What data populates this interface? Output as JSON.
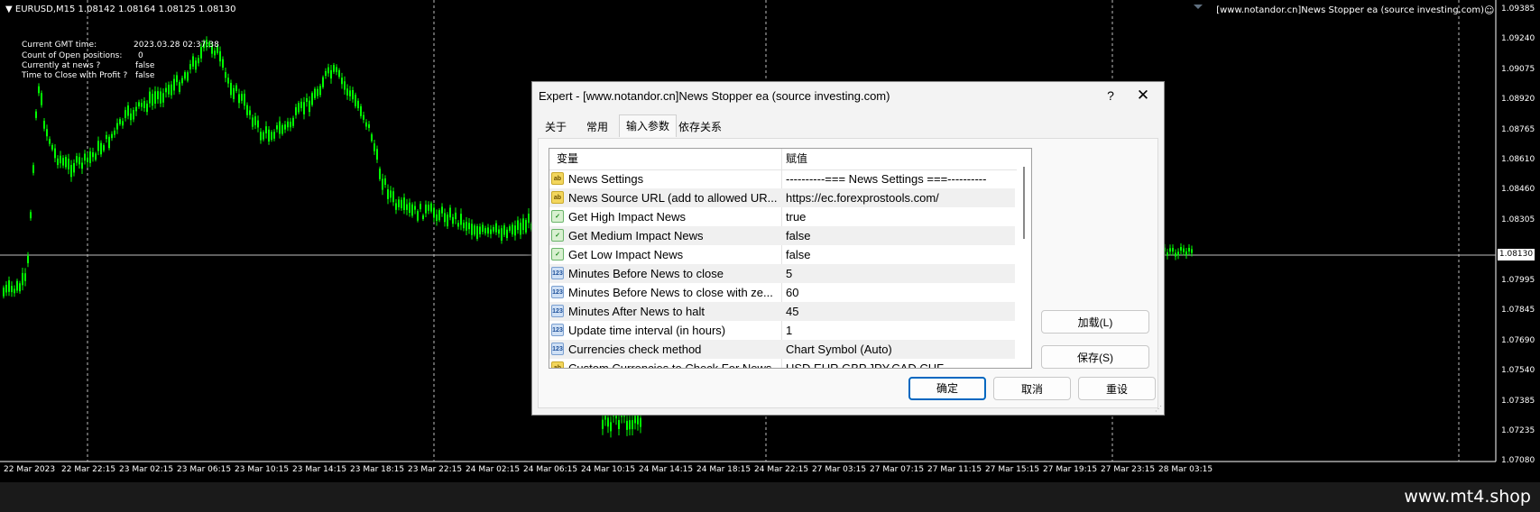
{
  "chart": {
    "symbol_info": "EURUSD,M15  1.08142 1.08164 1.08125 1.08130",
    "ea_title": "[www.notandor.cn]News Stopper ea (source investing.com)",
    "smile_icon": "smiley-face-icon",
    "info_panel": [
      {
        "label": "Current GMT time:",
        "value": "2023.03.28 02:37:38"
      },
      {
        "label": "Count of Open positions:",
        "value": "0"
      },
      {
        "label": "Currently at news ?",
        "value": "false"
      },
      {
        "label": "Time to Close with Profit ?",
        "value": "false"
      }
    ],
    "price_labels": [
      "1.09385",
      "1.09240",
      "1.09075",
      "1.08920",
      "1.08765",
      "1.08610",
      "1.08460",
      "1.08305",
      "1.08130",
      "1.07995",
      "1.07845",
      "1.07690",
      "1.07540",
      "1.07385",
      "1.07235",
      "1.07080"
    ],
    "current_price": "1.08130",
    "time_labels": [
      "22 Mar 2023",
      "22 Mar 22:15",
      "23 Mar 02:15",
      "23 Mar 06:15",
      "23 Mar 10:15",
      "23 Mar 14:15",
      "23 Mar 18:15",
      "23 Mar 22:15",
      "24 Mar 02:15",
      "24 Mar 06:15",
      "24 Mar 10:15",
      "24 Mar 14:15",
      "24 Mar 18:15",
      "24 Mar 22:15",
      "27 Mar 03:15",
      "27 Mar 07:15",
      "27 Mar 11:15",
      "27 Mar 15:15",
      "27 Mar 19:15",
      "27 Mar 23:15",
      "28 Mar 03:15"
    ],
    "candle_color": "#00ff00",
    "background": "#000000"
  },
  "watermark": "www.mt4.shop",
  "dialog": {
    "title": "Expert - [www.notandor.cn]News Stopper ea (source investing.com)",
    "help_label": "?",
    "close_label": "✕",
    "tabs": [
      "关于",
      "常用",
      "输入参数",
      "依存关系"
    ],
    "active_tab": "输入参数",
    "columns": {
      "variable": "变量",
      "value": "赋值"
    },
    "params": [
      {
        "icon": "ab",
        "name": "News Settings",
        "value": "----------=== News Settings ===----------"
      },
      {
        "icon": "ab",
        "name": "News Source URL (add to allowed UR...",
        "value": "https://ec.forexprostools.com/"
      },
      {
        "icon": "bool",
        "name": "Get High Impact News",
        "value": "true"
      },
      {
        "icon": "bool",
        "name": "Get Medium Impact News",
        "value": "false"
      },
      {
        "icon": "bool",
        "name": "Get Low Impact News",
        "value": "false"
      },
      {
        "icon": "123",
        "name": "Minutes Before News to close",
        "value": "5"
      },
      {
        "icon": "123",
        "name": "Minutes Before News to close with ze...",
        "value": "60"
      },
      {
        "icon": "123",
        "name": "Minutes After News to halt",
        "value": "45"
      },
      {
        "icon": "123",
        "name": "Update time interval (in hours)",
        "value": "1"
      },
      {
        "icon": "123",
        "name": "Currencies check method",
        "value": "Chart Symbol (Auto)"
      },
      {
        "icon": "ab",
        "name": "Custom Currencies to Check For News",
        "value": "USD,EUR,GBP,JPY,CAD,CHF"
      }
    ],
    "load_button": "加载(L)",
    "save_button": "保存(S)",
    "ok_button": "确定",
    "cancel_button": "取消",
    "reset_button": "重设"
  }
}
